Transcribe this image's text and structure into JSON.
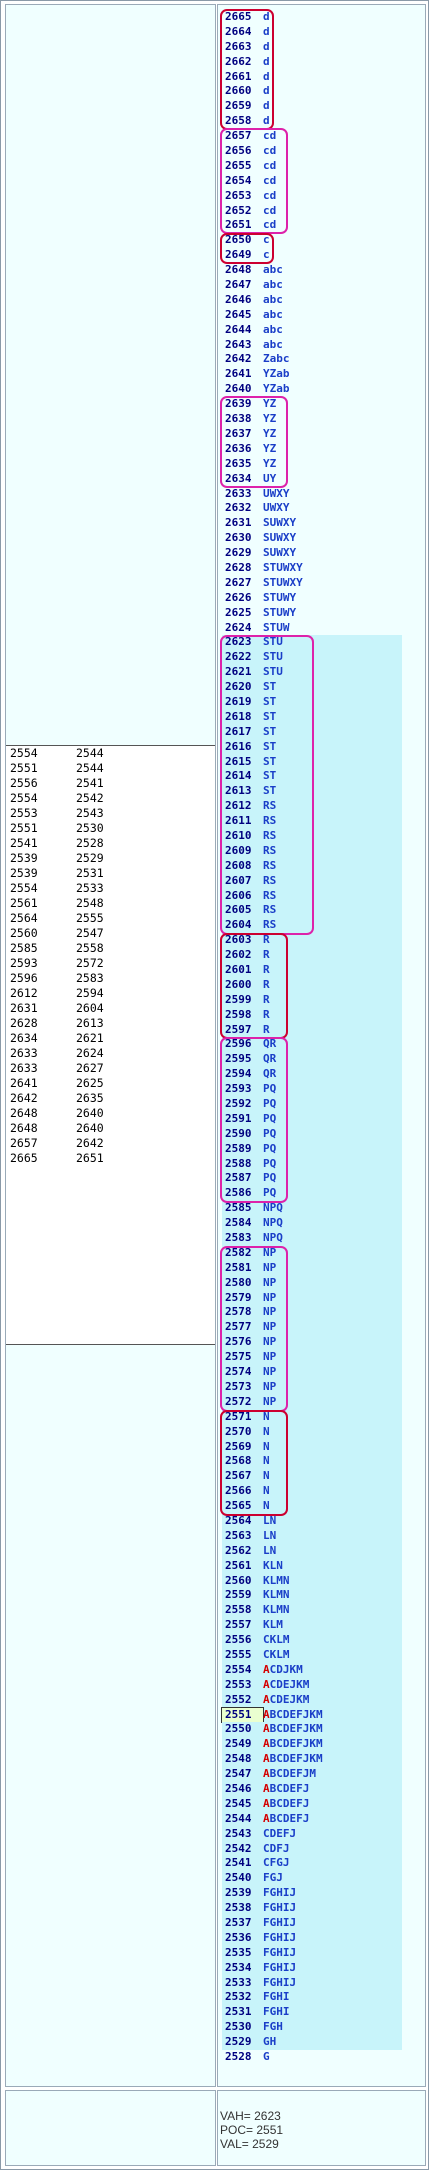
{
  "left_table": {
    "rows": [
      [
        "2554",
        "2544"
      ],
      [
        "2551",
        "2544"
      ],
      [
        "2556",
        "2541"
      ],
      [
        "2554",
        "2542"
      ],
      [
        "2553",
        "2543"
      ],
      [
        "2551",
        "2530"
      ],
      [
        "2541",
        "2528"
      ],
      [
        "2539",
        "2529"
      ],
      [
        "2539",
        "2531"
      ],
      [
        "2554",
        "2533"
      ],
      [
        "2561",
        "2548"
      ],
      [
        "2564",
        "2555"
      ],
      [
        "2560",
        "2547"
      ],
      [
        "2585",
        "2558"
      ],
      [
        "2593",
        "2572"
      ],
      [
        "2596",
        "2583"
      ],
      [
        "2612",
        "2594"
      ],
      [
        "2631",
        "2604"
      ],
      [
        "2628",
        "2613"
      ],
      [
        "2634",
        "2621"
      ],
      [
        "2633",
        "2624"
      ],
      [
        "2633",
        "2627"
      ],
      [
        "2641",
        "2625"
      ],
      [
        "2642",
        "2635"
      ],
      [
        "2648",
        "2640"
      ],
      [
        "2648",
        "2640"
      ],
      [
        "2657",
        "2642"
      ],
      [
        "2665",
        "2651"
      ]
    ]
  },
  "profile": {
    "rows": [
      {
        "p": "2665",
        "t": "d"
      },
      {
        "p": "2664",
        "t": "d"
      },
      {
        "p": "2663",
        "t": "d"
      },
      {
        "p": "2662",
        "t": "d"
      },
      {
        "p": "2661",
        "t": "d"
      },
      {
        "p": "2660",
        "t": "d"
      },
      {
        "p": "2659",
        "t": "d"
      },
      {
        "p": "2658",
        "t": "d"
      },
      {
        "p": "2657",
        "t": "cd"
      },
      {
        "p": "2656",
        "t": "cd"
      },
      {
        "p": "2655",
        "t": "cd"
      },
      {
        "p": "2654",
        "t": "cd"
      },
      {
        "p": "2653",
        "t": "cd"
      },
      {
        "p": "2652",
        "t": "cd"
      },
      {
        "p": "2651",
        "t": "cd"
      },
      {
        "p": "2650",
        "t": "c"
      },
      {
        "p": "2649",
        "t": "c"
      },
      {
        "p": "2648",
        "t": "abc"
      },
      {
        "p": "2647",
        "t": "abc"
      },
      {
        "p": "2646",
        "t": "abc"
      },
      {
        "p": "2645",
        "t": "abc"
      },
      {
        "p": "2644",
        "t": "abc"
      },
      {
        "p": "2643",
        "t": "abc"
      },
      {
        "p": "2642",
        "t": "Zabc"
      },
      {
        "p": "2641",
        "t": "YZab"
      },
      {
        "p": "2640",
        "t": "YZab"
      },
      {
        "p": "2639",
        "t": "YZ"
      },
      {
        "p": "2638",
        "t": "YZ"
      },
      {
        "p": "2637",
        "t": "YZ"
      },
      {
        "p": "2636",
        "t": "YZ"
      },
      {
        "p": "2635",
        "t": "YZ"
      },
      {
        "p": "2634",
        "t": "UY"
      },
      {
        "p": "2633",
        "t": "UWXY"
      },
      {
        "p": "2632",
        "t": "UWXY"
      },
      {
        "p": "2631",
        "t": "SUWXY"
      },
      {
        "p": "2630",
        "t": "SUWXY"
      },
      {
        "p": "2629",
        "t": "SUWXY"
      },
      {
        "p": "2628",
        "t": "STUWXY"
      },
      {
        "p": "2627",
        "t": "STUWXY"
      },
      {
        "p": "2626",
        "t": "STUWY"
      },
      {
        "p": "2625",
        "t": "STUWY"
      },
      {
        "p": "2624",
        "t": "STUW"
      },
      {
        "p": "2623",
        "t": "STU"
      },
      {
        "p": "2622",
        "t": "STU"
      },
      {
        "p": "2621",
        "t": "STU"
      },
      {
        "p": "2620",
        "t": "ST"
      },
      {
        "p": "2619",
        "t": "ST"
      },
      {
        "p": "2618",
        "t": "ST"
      },
      {
        "p": "2617",
        "t": "ST"
      },
      {
        "p": "2616",
        "t": "ST"
      },
      {
        "p": "2615",
        "t": "ST"
      },
      {
        "p": "2614",
        "t": "ST"
      },
      {
        "p": "2613",
        "t": "ST"
      },
      {
        "p": "2612",
        "t": "RS"
      },
      {
        "p": "2611",
        "t": "RS"
      },
      {
        "p": "2610",
        "t": "RS"
      },
      {
        "p": "2609",
        "t": "RS"
      },
      {
        "p": "2608",
        "t": "RS"
      },
      {
        "p": "2607",
        "t": "RS"
      },
      {
        "p": "2606",
        "t": "RS"
      },
      {
        "p": "2605",
        "t": "RS"
      },
      {
        "p": "2604",
        "t": "RS"
      },
      {
        "p": "2603",
        "t": "R"
      },
      {
        "p": "2602",
        "t": "R"
      },
      {
        "p": "2601",
        "t": "R"
      },
      {
        "p": "2600",
        "t": "R"
      },
      {
        "p": "2599",
        "t": "R"
      },
      {
        "p": "2598",
        "t": "R"
      },
      {
        "p": "2597",
        "t": "R"
      },
      {
        "p": "2596",
        "t": "QR"
      },
      {
        "p": "2595",
        "t": "QR"
      },
      {
        "p": "2594",
        "t": "QR"
      },
      {
        "p": "2593",
        "t": "PQ"
      },
      {
        "p": "2592",
        "t": "PQ"
      },
      {
        "p": "2591",
        "t": "PQ"
      },
      {
        "p": "2590",
        "t": "PQ"
      },
      {
        "p": "2589",
        "t": "PQ"
      },
      {
        "p": "2588",
        "t": "PQ"
      },
      {
        "p": "2587",
        "t": "PQ"
      },
      {
        "p": "2586",
        "t": "PQ"
      },
      {
        "p": "2585",
        "t": "NPQ"
      },
      {
        "p": "2584",
        "t": "NPQ"
      },
      {
        "p": "2583",
        "t": "NPQ"
      },
      {
        "p": "2582",
        "t": "NP"
      },
      {
        "p": "2581",
        "t": "NP"
      },
      {
        "p": "2580",
        "t": "NP"
      },
      {
        "p": "2579",
        "t": "NP"
      },
      {
        "p": "2578",
        "t": "NP"
      },
      {
        "p": "2577",
        "t": "NP"
      },
      {
        "p": "2576",
        "t": "NP"
      },
      {
        "p": "2575",
        "t": "NP"
      },
      {
        "p": "2574",
        "t": "NP"
      },
      {
        "p": "2573",
        "t": "NP"
      },
      {
        "p": "2572",
        "t": "NP"
      },
      {
        "p": "2571",
        "t": "N"
      },
      {
        "p": "2570",
        "t": "N"
      },
      {
        "p": "2569",
        "t": "N"
      },
      {
        "p": "2568",
        "t": "N"
      },
      {
        "p": "2567",
        "t": "N"
      },
      {
        "p": "2566",
        "t": "N"
      },
      {
        "p": "2565",
        "t": "N"
      },
      {
        "p": "2564",
        "t": "LN"
      },
      {
        "p": "2563",
        "t": "LN"
      },
      {
        "p": "2562",
        "t": "LN"
      },
      {
        "p": "2561",
        "t": "KLN"
      },
      {
        "p": "2560",
        "t": "KLMN"
      },
      {
        "p": "2559",
        "t": "KLMN"
      },
      {
        "p": "2558",
        "t": "KLMN"
      },
      {
        "p": "2557",
        "t": "KLM"
      },
      {
        "p": "2556",
        "t": "CKLM"
      },
      {
        "p": "2555",
        "t": "CKLM"
      },
      {
        "p": "2554",
        "t": "ACDJKM"
      },
      {
        "p": "2553",
        "t": "ACDEJKM"
      },
      {
        "p": "2552",
        "t": "ACDEJKM"
      },
      {
        "p": "2551",
        "t": "ABCDEFJKM"
      },
      {
        "p": "2550",
        "t": "ABCDEFJKM"
      },
      {
        "p": "2549",
        "t": "ABCDEFJKM"
      },
      {
        "p": "2548",
        "t": "ABCDEFJKM"
      },
      {
        "p": "2547",
        "t": "ABCDEFJM"
      },
      {
        "p": "2546",
        "t": "ABCDEFJ"
      },
      {
        "p": "2545",
        "t": "ABCDEFJ"
      },
      {
        "p": "2544",
        "t": "ABCDEFJ"
      },
      {
        "p": "2543",
        "t": "CDEFJ"
      },
      {
        "p": "2542",
        "t": "CDFJ"
      },
      {
        "p": "2541",
        "t": "CFGJ"
      },
      {
        "p": "2540",
        "t": "FGJ"
      },
      {
        "p": "2539",
        "t": "FGHIJ"
      },
      {
        "p": "2538",
        "t": "FGHIJ"
      },
      {
        "p": "2537",
        "t": "FGHIJ"
      },
      {
        "p": "2536",
        "t": "FGHIJ"
      },
      {
        "p": "2535",
        "t": "FGHIJ"
      },
      {
        "p": "2534",
        "t": "FGHIJ"
      },
      {
        "p": "2533",
        "t": "FGHIJ"
      },
      {
        "p": "2532",
        "t": "FGHI"
      },
      {
        "p": "2531",
        "t": "FGHI"
      },
      {
        "p": "2530",
        "t": "FGH"
      },
      {
        "p": "2529",
        "t": "GH"
      },
      {
        "p": "2528",
        "t": "G"
      }
    ],
    "poc_price": "2551",
    "va_high": 2623,
    "va_low": 2529,
    "red_count_prices": [
      "2554",
      "2553",
      "2552",
      "2551",
      "2550",
      "2549",
      "2548",
      "2547",
      "2546",
      "2545",
      "2544"
    ],
    "boxes": [
      {
        "from": "2665",
        "to": "2658",
        "color": "red",
        "cols": 2
      },
      {
        "from": "2657",
        "to": "2651",
        "color": "mag",
        "cols": 3
      },
      {
        "from": "2650",
        "to": "2649",
        "color": "red",
        "cols": 2
      },
      {
        "from": "2639",
        "to": "2634",
        "color": "mag",
        "cols": 3
      },
      {
        "from": "2623",
        "to": "2604",
        "color": "mag",
        "cols": 4
      },
      {
        "from": "2603",
        "to": "2597",
        "color": "red",
        "cols": 3
      },
      {
        "from": "2596",
        "to": "2586",
        "color": "mag",
        "cols": 3
      },
      {
        "from": "2582",
        "to": "2572",
        "color": "mag",
        "cols": 3
      },
      {
        "from": "2571",
        "to": "2565",
        "color": "red",
        "cols": 3
      }
    ]
  },
  "stats": {
    "vah": "VAH= 2623",
    "poc": "POC= 2551",
    "val": "VAL= 2529"
  },
  "colors": {
    "panel_bg": "#f0ffff",
    "value_area": "#c8f4fa",
    "tpo_blue": "#1a3ec8",
    "tpo_red": "#d40000",
    "box_red": "#cc0030",
    "box_magenta": "#dd22aa"
  }
}
